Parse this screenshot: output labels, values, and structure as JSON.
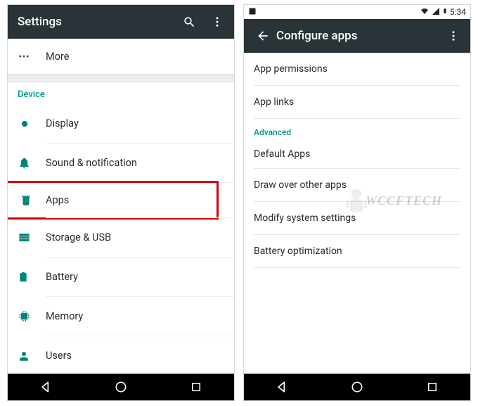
{
  "left": {
    "toolbar_title": "Settings",
    "more_label": "More",
    "device_header": "Device",
    "items": {
      "display": "Display",
      "sound": "Sound & notification",
      "apps": "Apps",
      "storage": "Storage & USB",
      "battery": "Battery",
      "memory": "Memory",
      "users": "Users"
    }
  },
  "right": {
    "status_time": "5:34",
    "toolbar_title": "Configure apps",
    "items": {
      "permissions": "App permissions",
      "links": "App links",
      "default": "Default Apps",
      "overlay": "Draw over other apps",
      "modify": "Modify system settings",
      "battery_opt": "Battery optimization"
    },
    "advanced_header": "Advanced"
  },
  "watermark": "WCCFTECH"
}
